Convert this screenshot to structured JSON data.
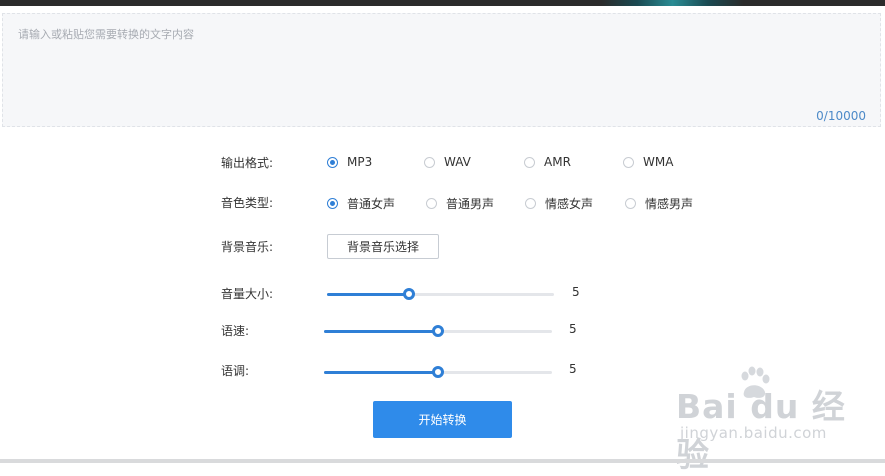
{
  "textarea": {
    "placeholder": "请输入或粘贴您需要转换的文字内容",
    "counter": "0/10000"
  },
  "format": {
    "label": "输出格式:",
    "options": [
      "MP3",
      "WAV",
      "AMR",
      "WMA"
    ],
    "selected": "MP3"
  },
  "voice": {
    "label": "音色类型:",
    "options": [
      "普通女声",
      "普通男声",
      "情感女声",
      "情感男声"
    ],
    "selected": "普通女声"
  },
  "bgm": {
    "label": "背景音乐:",
    "button": "背景音乐选择"
  },
  "volume": {
    "label": "音量大小:",
    "value": "5",
    "level": 0.36
  },
  "speed": {
    "label": "语速:",
    "value": "5",
    "level": 0.5
  },
  "pitch": {
    "label": "语调:",
    "value": "5",
    "level": 0.5
  },
  "start_button": "开始转换",
  "watermark": {
    "logo": "Bai du 经验",
    "url": "jingyan.baidu.com"
  },
  "colors": {
    "accent": "#2f7fd6",
    "button": "#2f8bea",
    "counter": "#4d8ac8"
  },
  "icons": [
    "radio-icon",
    "slider-thumb-icon",
    "baidu-paw-icon"
  ]
}
